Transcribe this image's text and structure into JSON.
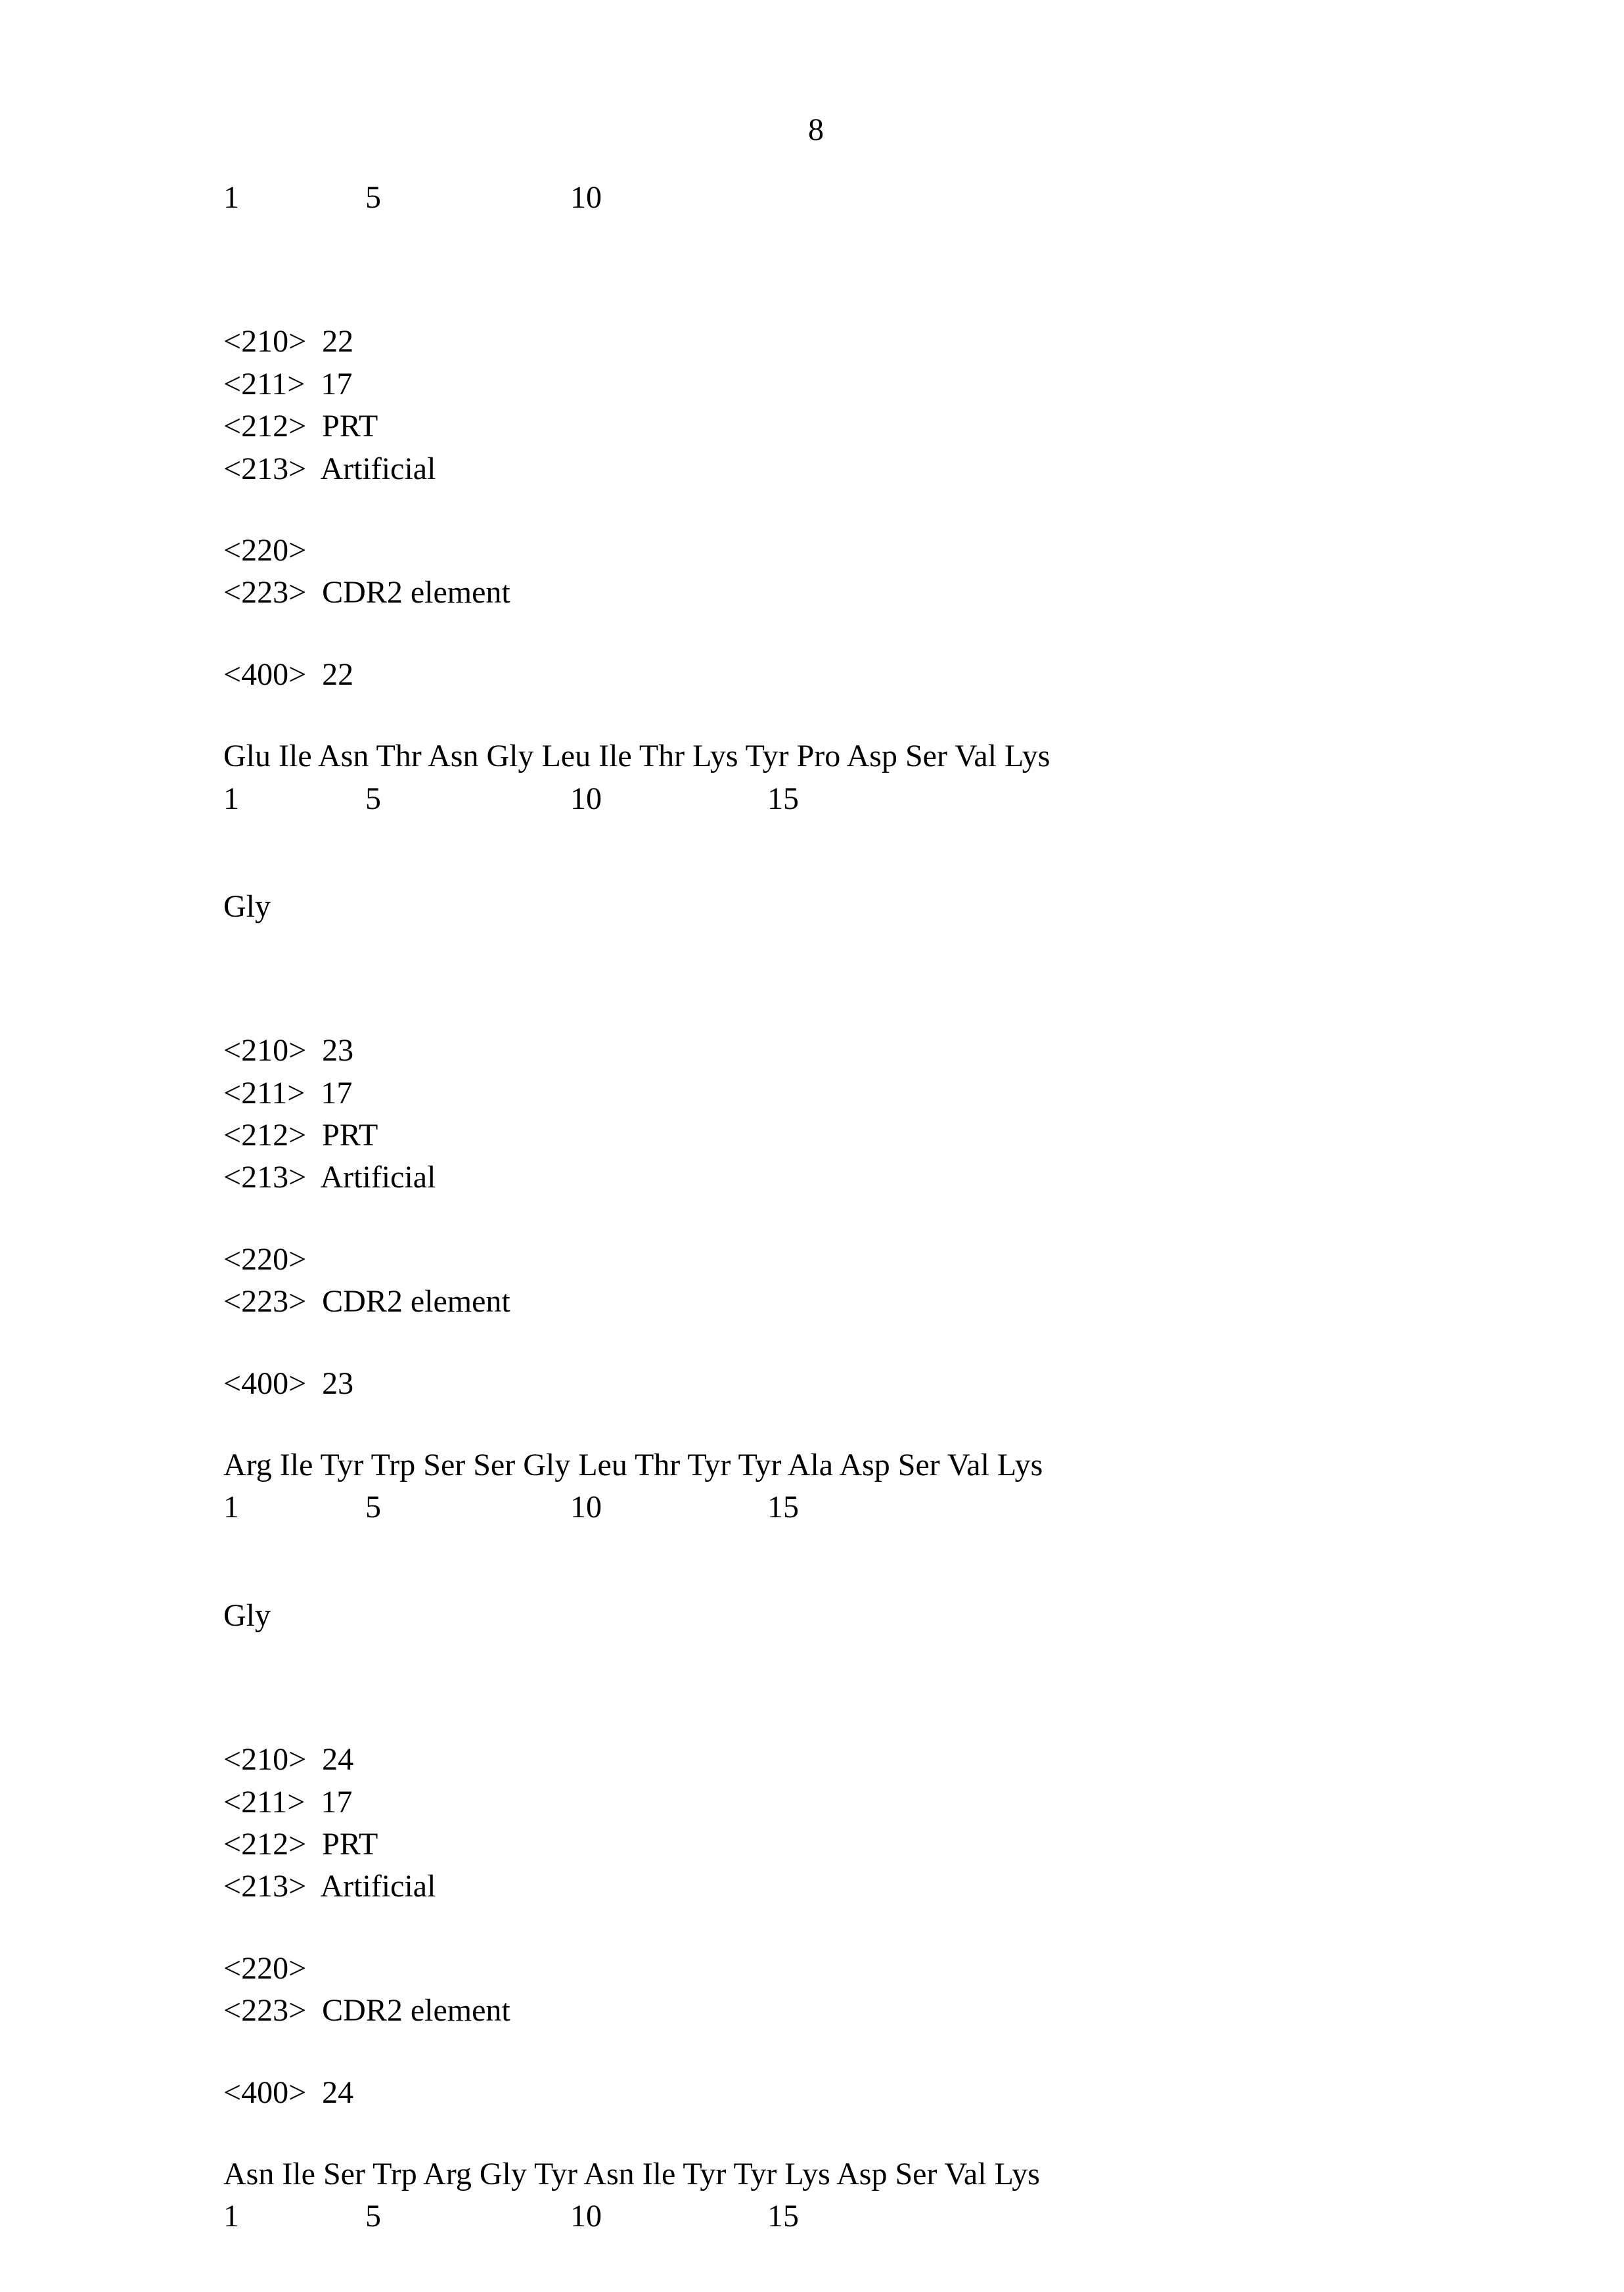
{
  "page_number": "8",
  "block0": {
    "ruler": "1                5                        10"
  },
  "seq22": {
    "h210": "<210>  22",
    "h211": "<211>  17",
    "h212": "<212>  PRT",
    "h213": "<213>  Artificial",
    "h220": "<220>",
    "h223": "<223>  CDR2 element",
    "h400": "<400>  22",
    "seqline": "Glu Ile Asn Thr Asn Gly Leu Ile Thr Lys Tyr Pro Asp Ser Val Lys",
    "ruler": "1                5                        10                     15",
    "tail": "Gly"
  },
  "seq23": {
    "h210": "<210>  23",
    "h211": "<211>  17",
    "h212": "<212>  PRT",
    "h213": "<213>  Artificial",
    "h220": "<220>",
    "h223": "<223>  CDR2 element",
    "h400": "<400>  23",
    "seqline": "Arg Ile Tyr Trp Ser Ser Gly Leu Thr Tyr Tyr Ala Asp Ser Val Lys",
    "ruler": "1                5                        10                     15",
    "tail": "Gly"
  },
  "seq24": {
    "h210": "<210>  24",
    "h211": "<211>  17",
    "h212": "<212>  PRT",
    "h213": "<213>  Artificial",
    "h220": "<220>",
    "h223": "<223>  CDR2 element",
    "h400": "<400>  24",
    "seqline": "Asn Ile Ser Trp Arg Gly Tyr Asn Ile Tyr Tyr Lys Asp Ser Val Lys",
    "ruler": "1                5                        10                     15"
  }
}
